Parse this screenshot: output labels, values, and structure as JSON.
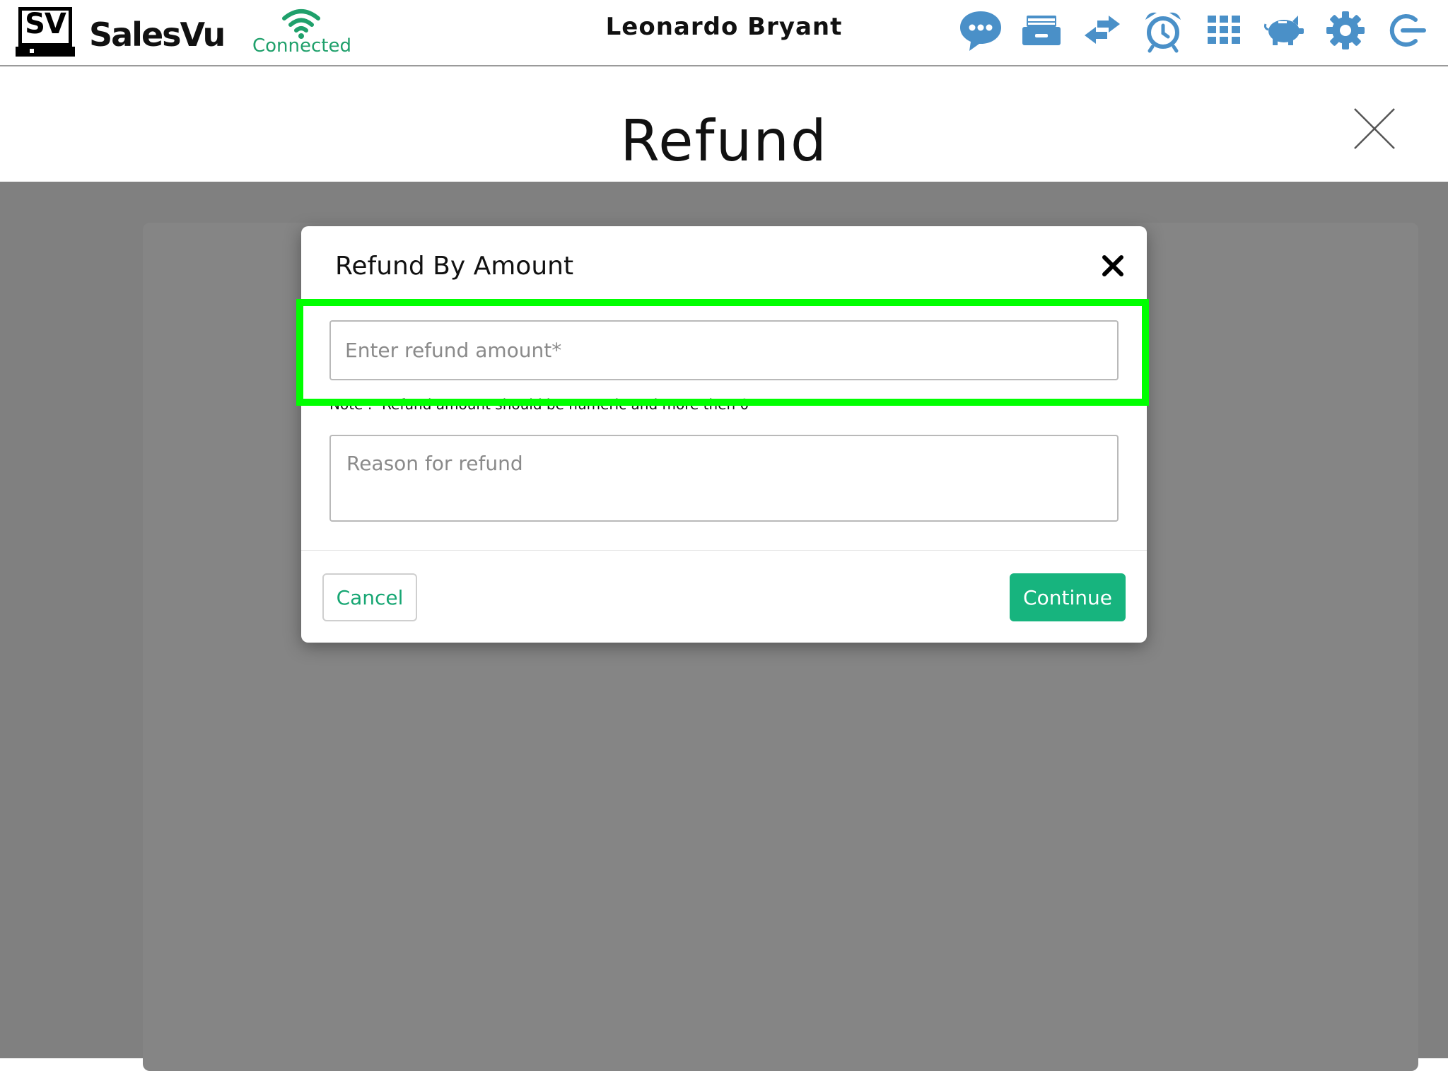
{
  "app": {
    "brand_logo_text": "SV",
    "brand_name": "SalesVu",
    "connection_status": "Connected",
    "user_name": "Leonardo Bryant"
  },
  "toolbar": {
    "icons": [
      "chat-icon",
      "register-drawer-icon",
      "swap-icon",
      "alarm-clock-icon",
      "grid-menu-icon",
      "piggy-bank-icon",
      "settings-gear-icon",
      "logout-icon"
    ],
    "icon_color": "#4a90c8"
  },
  "page": {
    "title": "Refund"
  },
  "modal": {
    "title": "Refund By Amount",
    "amount_placeholder": "Enter refund amount*",
    "note": "Note :- Refund amount should be numeric and more then 0",
    "reason_placeholder": "Reason for refund",
    "cancel_label": "Cancel",
    "continue_label": "Continue"
  },
  "colors": {
    "accent_green": "#17b47e",
    "connected_green": "#1fa06b",
    "highlight": "#00ff00",
    "overlay": "#808080"
  }
}
